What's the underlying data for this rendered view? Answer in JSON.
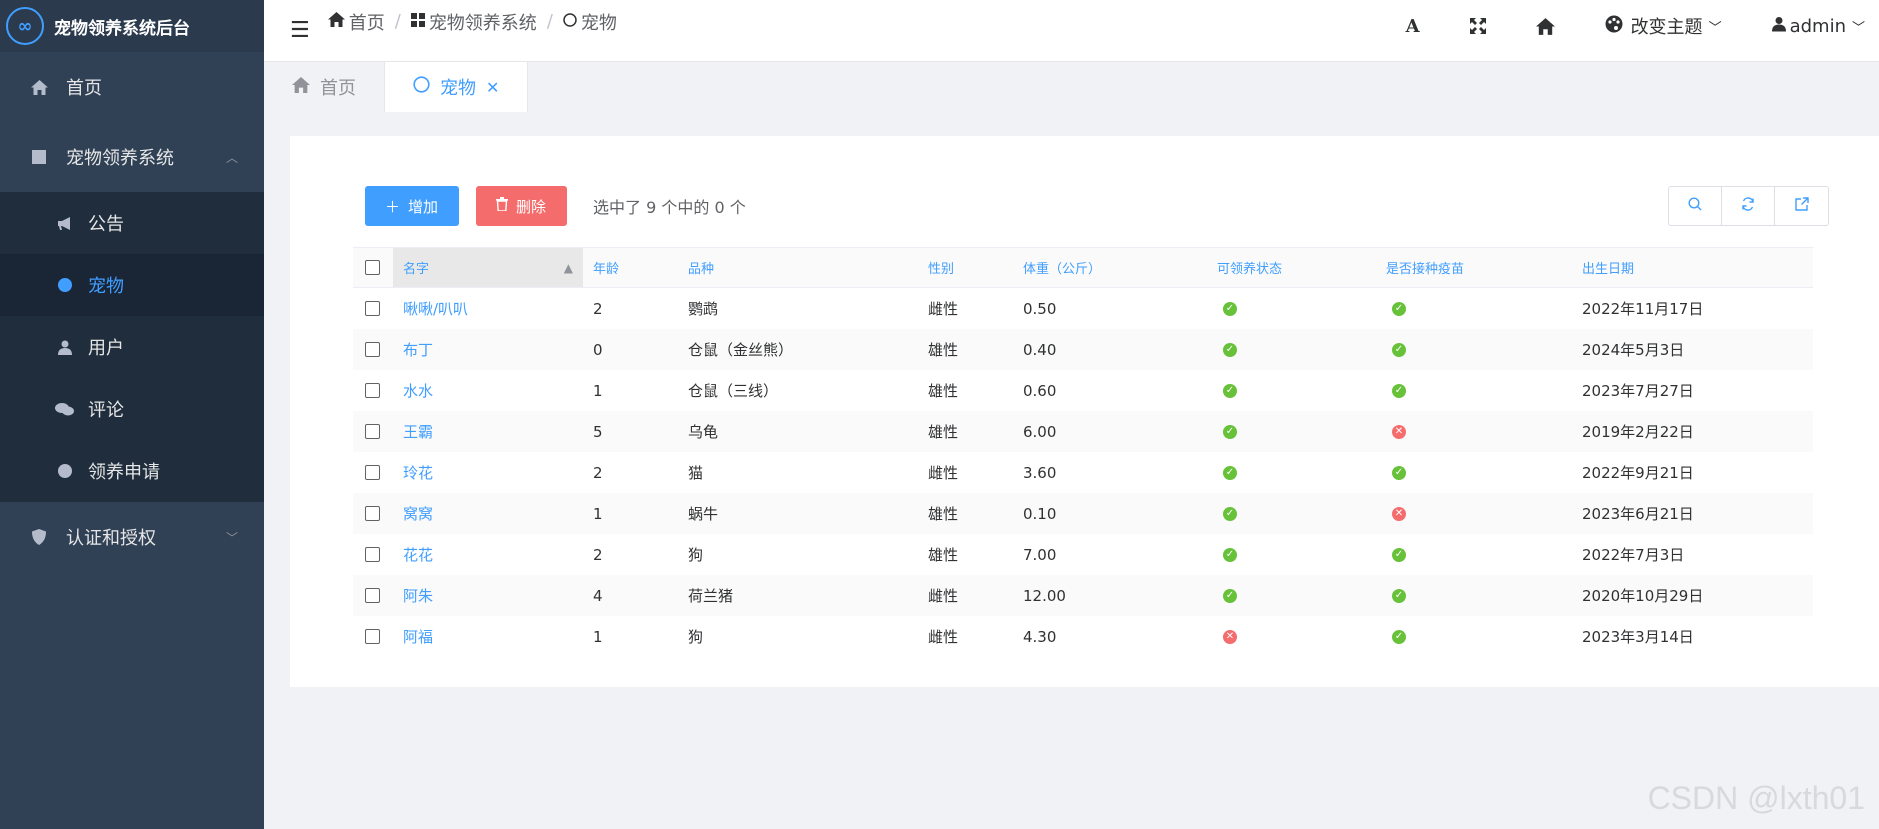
{
  "app": {
    "title": "宠物领养系统后台",
    "logo_glyph": "∞"
  },
  "sidebar": {
    "items": [
      {
        "label": "首页",
        "icon": "home-icon"
      },
      {
        "label": "宠物领养系统",
        "icon": "square-icon",
        "expanded": true,
        "children": [
          {
            "label": "公告",
            "icon": "bullhorn-icon"
          },
          {
            "label": "宠物",
            "icon": "circle-icon",
            "active": true
          },
          {
            "label": "用户",
            "icon": "user-icon"
          },
          {
            "label": "评论",
            "icon": "comments-icon"
          },
          {
            "label": "领养申请",
            "icon": "circle-icon"
          }
        ]
      },
      {
        "label": "认证和授权",
        "icon": "shield-icon",
        "expanded": false
      }
    ]
  },
  "header": {
    "breadcrumb": [
      "首页",
      "宠物领养系统",
      "宠物"
    ],
    "theme_label": "改变主题",
    "user": "admin"
  },
  "tabs": [
    {
      "label": "首页",
      "active": false
    },
    {
      "label": "宠物",
      "active": true,
      "closable": true
    }
  ],
  "toolbar": {
    "add_label": "增加",
    "delete_label": "删除",
    "selected_info": "选中了 9 个中的 0 个"
  },
  "table": {
    "columns": [
      "名字",
      "年龄",
      "品种",
      "性别",
      "体重（公斤）",
      "可领养状态",
      "是否接种疫苗",
      "出生日期"
    ],
    "rows": [
      {
        "name": "啾啾/叭叭",
        "age": "2",
        "breed": "鹦鹉",
        "gender": "雌性",
        "weight": "0.50",
        "adoptable": true,
        "vaccinated": true,
        "birth": "2022年11月17日"
      },
      {
        "name": "布丁",
        "age": "0",
        "breed": "仓鼠（金丝熊）",
        "gender": "雄性",
        "weight": "0.40",
        "adoptable": true,
        "vaccinated": true,
        "birth": "2024年5月3日"
      },
      {
        "name": "水水",
        "age": "1",
        "breed": "仓鼠（三线）",
        "gender": "雄性",
        "weight": "0.60",
        "adoptable": true,
        "vaccinated": true,
        "birth": "2023年7月27日"
      },
      {
        "name": "王霸",
        "age": "5",
        "breed": "乌龟",
        "gender": "雄性",
        "weight": "6.00",
        "adoptable": true,
        "vaccinated": false,
        "birth": "2019年2月22日"
      },
      {
        "name": "玲花",
        "age": "2",
        "breed": "猫",
        "gender": "雌性",
        "weight": "3.60",
        "adoptable": true,
        "vaccinated": true,
        "birth": "2022年9月21日"
      },
      {
        "name": "窝窝",
        "age": "1",
        "breed": "蜗牛",
        "gender": "雄性",
        "weight": "0.10",
        "adoptable": true,
        "vaccinated": false,
        "birth": "2023年6月21日"
      },
      {
        "name": "花花",
        "age": "2",
        "breed": "狗",
        "gender": "雄性",
        "weight": "7.00",
        "adoptable": true,
        "vaccinated": true,
        "birth": "2022年7月3日"
      },
      {
        "name": "阿朱",
        "age": "4",
        "breed": "荷兰猪",
        "gender": "雌性",
        "weight": "12.00",
        "adoptable": true,
        "vaccinated": true,
        "birth": "2020年10月29日"
      },
      {
        "name": "阿福",
        "age": "1",
        "breed": "狗",
        "gender": "雌性",
        "weight": "4.30",
        "adoptable": false,
        "vaccinated": true,
        "birth": "2023年3月14日"
      }
    ]
  },
  "watermark": "CSDN @lxth01",
  "colors": {
    "sidebar": "#304156",
    "accent": "#409eff",
    "danger": "#f56c6c",
    "success": "#67c23a"
  }
}
